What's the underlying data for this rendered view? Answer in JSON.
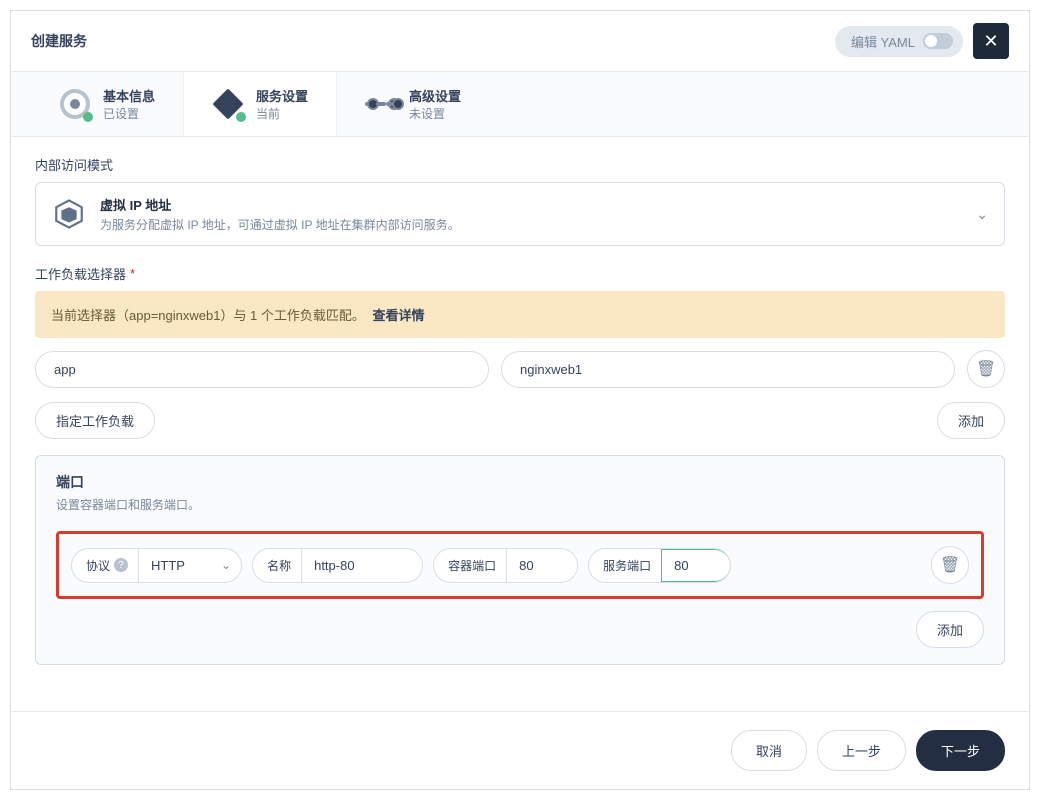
{
  "header": {
    "title": "创建服务",
    "yaml_label": "编辑 YAML"
  },
  "tabs": {
    "basic": {
      "title": "基本信息",
      "sub": "已设置"
    },
    "service": {
      "title": "服务设置",
      "sub": "当前"
    },
    "advanced": {
      "title": "高级设置",
      "sub": "未设置"
    }
  },
  "access": {
    "section_label": "内部访问模式",
    "card_title": "虚拟 IP 地址",
    "card_desc": "为服务分配虚拟 IP 地址，可通过虚拟 IP 地址在集群内部访问服务。"
  },
  "selector": {
    "section_label": "工作负载选择器",
    "banner_text": "当前选择器（app=nginxweb1）与 1 个工作负载匹配。",
    "banner_link": "查看详情",
    "key": "app",
    "value": "nginxweb1",
    "specify_btn": "指定工作负载",
    "add_btn": "添加"
  },
  "ports": {
    "heading": "端口",
    "sub": "设置容器端口和服务端口。",
    "protocol_label": "协议",
    "protocol_value": "HTTP",
    "name_label": "名称",
    "name_value": "http-80",
    "container_port_label": "容器端口",
    "container_port_value": "80",
    "service_port_label": "服务端口",
    "service_port_value": "80",
    "add_btn": "添加"
  },
  "footer": {
    "cancel": "取消",
    "prev": "上一步",
    "next": "下一步"
  }
}
